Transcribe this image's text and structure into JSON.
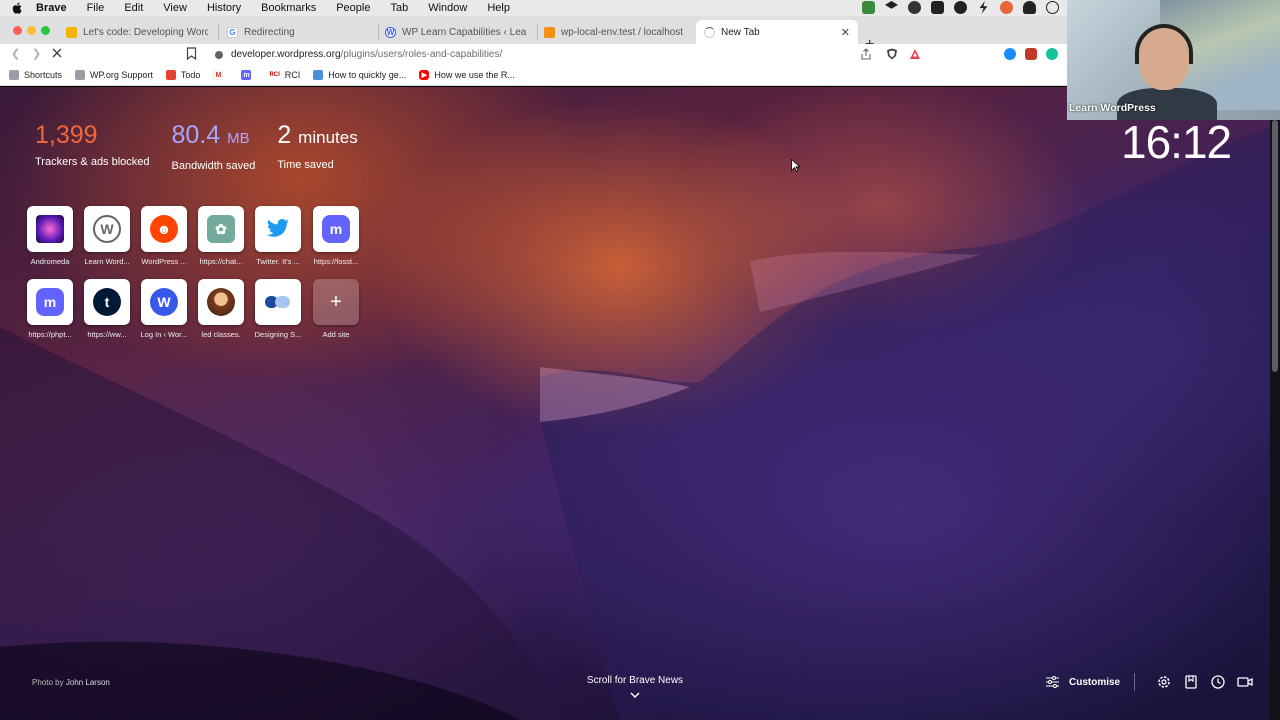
{
  "menubar": {
    "app": "Brave",
    "items": [
      "File",
      "Edit",
      "View",
      "History",
      "Bookmarks",
      "People",
      "Tab",
      "Window",
      "Help"
    ]
  },
  "tabs": [
    {
      "title": "Let's code: Developing WordPress",
      "favicon": "google-docs-icon",
      "color": "#f5b400"
    },
    {
      "title": "Redirecting",
      "favicon": "google-icon",
      "color": "#4285f4"
    },
    {
      "title": "WP Learn Capabilities ‹ LearnPress",
      "favicon": "wordpress-icon",
      "color": "#3858e9"
    },
    {
      "title": "wp-local-env.test / localhost / learn",
      "favicon": "phpmyadmin-icon",
      "color": "#f29111"
    },
    {
      "title": "New Tab",
      "favicon": "loading-icon",
      "color": "#888888"
    }
  ],
  "address": {
    "host": "developer.wordpress.org",
    "path": "/plugins/users/roles-and-capabilities/"
  },
  "bookmarks": [
    {
      "label": "Shortcuts",
      "icon": "folder-icon"
    },
    {
      "label": "WP.org Support",
      "icon": "folder-icon"
    },
    {
      "label": "Todo",
      "icon": "todo-icon"
    },
    {
      "label": "",
      "icon": "gmail-icon"
    },
    {
      "label": "",
      "icon": "mastodon-icon"
    },
    {
      "label": "RCI",
      "icon": "rci-icon"
    },
    {
      "label": "How to quickly ge...",
      "icon": "puzzle-icon"
    },
    {
      "label": "How we use the R...",
      "icon": "youtube-icon"
    }
  ],
  "stats": {
    "trackers": {
      "value": "1,399",
      "label": "Trackers & ads blocked"
    },
    "bandwidth": {
      "value": "80.4",
      "unit": "MB",
      "label": "Bandwidth saved"
    },
    "time": {
      "value": "2",
      "unit": "minutes",
      "label": "Time saved"
    }
  },
  "top_sites": [
    {
      "name": "Andromeda",
      "icon": "andromeda-icon"
    },
    {
      "name": "Learn Word...",
      "icon": "wordpress-icon"
    },
    {
      "name": "WordPress ...",
      "icon": "reddit-icon"
    },
    {
      "name": "https://chat...",
      "icon": "chatgpt-icon"
    },
    {
      "name": "Twitter. It's ...",
      "icon": "twitter-icon"
    },
    {
      "name": "https://fosst...",
      "icon": "mastodon-icon"
    },
    {
      "name": "https://phpt...",
      "icon": "mastodon-icon"
    },
    {
      "name": "https://ww...",
      "icon": "tumblr-icon"
    },
    {
      "name": "Log In ‹ Wor...",
      "icon": "wordpress-icon"
    },
    {
      "name": "led classes.",
      "icon": "avatar-icon"
    },
    {
      "name": "Designing S...",
      "icon": "designing-icon"
    },
    {
      "name": "Add site",
      "icon": "plus-icon"
    }
  ],
  "clock": "16:12",
  "photo_credit": {
    "prefix": "Photo by",
    "author": "John Larson"
  },
  "scroll_news": "Scroll for Brave News",
  "customise": "Customise",
  "webcam_label": "Learn WordPress",
  "colors": {
    "trackers": "#f0663d",
    "bandwidth": "#a9a6ff",
    "wordpress": "#3858e9",
    "mastodon": "#6364ff",
    "twitter": "#1d9bf0",
    "reddit": "#ff4500",
    "chatgpt": "#10a37f",
    "tumblr": "#001935"
  }
}
